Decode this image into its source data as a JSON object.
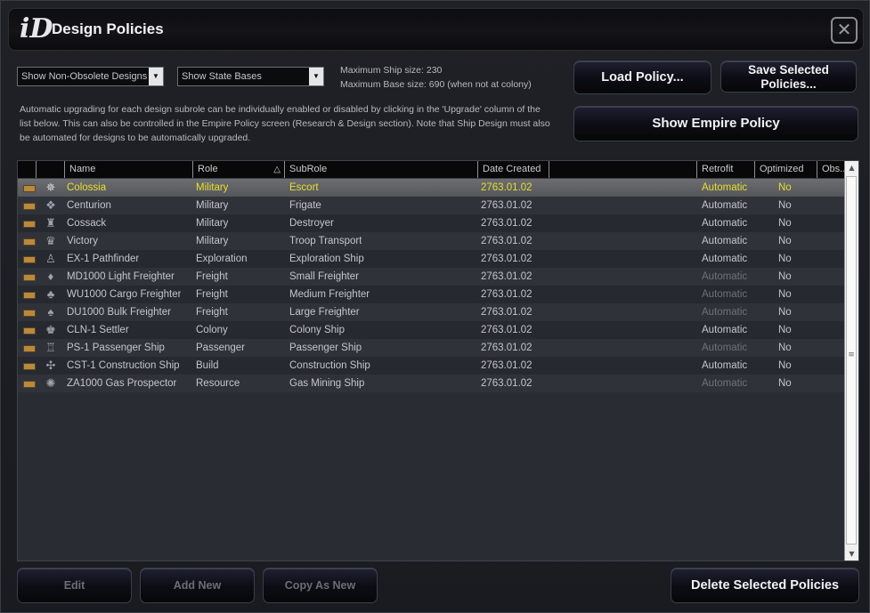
{
  "window": {
    "title": "Design Policies",
    "logo_text": "iD"
  },
  "filters": {
    "obsolete": "Show Non-Obsolete Designs",
    "bases": "Show State Bases"
  },
  "info": {
    "max_ship": "Maximum Ship size: 230",
    "max_base": "Maximum Base size: 690 (when not at colony)"
  },
  "description": "Automatic upgrading for each design subrole can be individually enabled or disabled by clicking in the 'Upgrade' column of the list below. This can also be controlled in the Empire Policy screen (Research & Design section). Note that Ship Design must also be automated for designs to be automatically upgraded.",
  "buttons": {
    "load": "Load Policy...",
    "save": "Save Selected Policies...",
    "show_empire": "Show Empire Policy",
    "edit": "Edit",
    "add_new": "Add New",
    "copy_as_new": "Copy As New",
    "delete": "Delete Selected Policies"
  },
  "table": {
    "columns": [
      "",
      "",
      "Name",
      "Role",
      "SubRole",
      "Date Created",
      "",
      "Retrofit",
      "Optimized",
      "Obs..."
    ],
    "sort_indicator": "△",
    "rows": [
      {
        "name": "Colossia",
        "role": "Military",
        "subrole": "Escort",
        "date": "2763.01.02",
        "retrofit": "Automatic",
        "retrofit_dim": false,
        "optimized": "No",
        "selected": true
      },
      {
        "name": "Centurion",
        "role": "Military",
        "subrole": "Frigate",
        "date": "2763.01.02",
        "retrofit": "Automatic",
        "retrofit_dim": false,
        "optimized": "No",
        "selected": false
      },
      {
        "name": "Cossack",
        "role": "Military",
        "subrole": "Destroyer",
        "date": "2763.01.02",
        "retrofit": "Automatic",
        "retrofit_dim": false,
        "optimized": "No",
        "selected": false
      },
      {
        "name": "Victory",
        "role": "Military",
        "subrole": "Troop Transport",
        "date": "2763.01.02",
        "retrofit": "Automatic",
        "retrofit_dim": false,
        "optimized": "No",
        "selected": false
      },
      {
        "name": "EX-1 Pathfinder",
        "role": "Exploration",
        "subrole": "Exploration Ship",
        "date": "2763.01.02",
        "retrofit": "Automatic",
        "retrofit_dim": false,
        "optimized": "No",
        "selected": false
      },
      {
        "name": "MD1000 Light Freighter",
        "role": "Freight",
        "subrole": "Small Freighter",
        "date": "2763.01.02",
        "retrofit": "Automatic",
        "retrofit_dim": true,
        "optimized": "No",
        "selected": false
      },
      {
        "name": "WU1000 Cargo Freighter",
        "role": "Freight",
        "subrole": "Medium Freighter",
        "date": "2763.01.02",
        "retrofit": "Automatic",
        "retrofit_dim": true,
        "optimized": "No",
        "selected": false
      },
      {
        "name": "DU1000 Bulk Freighter",
        "role": "Freight",
        "subrole": "Large Freighter",
        "date": "2763.01.02",
        "retrofit": "Automatic",
        "retrofit_dim": true,
        "optimized": "No",
        "selected": false
      },
      {
        "name": "CLN-1 Settler",
        "role": "Colony",
        "subrole": "Colony Ship",
        "date": "2763.01.02",
        "retrofit": "Automatic",
        "retrofit_dim": false,
        "optimized": "No",
        "selected": false
      },
      {
        "name": "PS-1 Passenger Ship",
        "role": "Passenger",
        "subrole": "Passenger Ship",
        "date": "2763.01.02",
        "retrofit": "Automatic",
        "retrofit_dim": true,
        "optimized": "No",
        "selected": false
      },
      {
        "name": "CST-1 Construction Ship",
        "role": "Build",
        "subrole": "Construction Ship",
        "date": "2763.01.02",
        "retrofit": "Automatic",
        "retrofit_dim": false,
        "optimized": "No",
        "selected": false
      },
      {
        "name": "ZA1000 Gas Prospector",
        "role": "Resource",
        "subrole": "Gas Mining Ship",
        "date": "2763.01.02",
        "retrofit": "Automatic",
        "retrofit_dim": true,
        "optimized": "No",
        "selected": false
      }
    ]
  }
}
